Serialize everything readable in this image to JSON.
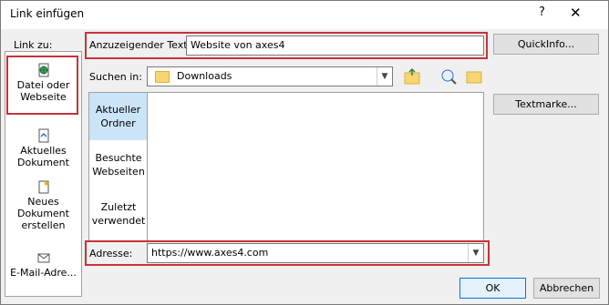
{
  "window": {
    "title": "Link einfügen",
    "help_label": "?",
    "close_label": "✕"
  },
  "link_to": {
    "label": "Link zu:",
    "items": [
      {
        "label": "Datei oder Webseite",
        "icon": "globe-file-icon",
        "selected": true
      },
      {
        "label": "Aktuelles Dokument",
        "icon": "document-arrow-icon",
        "selected": false
      },
      {
        "label": "Neues Dokument erstellen",
        "icon": "new-document-icon",
        "selected": false
      },
      {
        "label": "E-Mail-Adre...",
        "icon": "email-icon",
        "selected": false
      }
    ]
  },
  "display_text": {
    "label": "Anzuzeigender Text:",
    "value": "Website von axes4"
  },
  "quickinfo_button": "QuickInfo...",
  "search_in": {
    "label": "Suchen in:",
    "value": "Downloads"
  },
  "bookmark_button": "Textmarke...",
  "browse_tabs": [
    {
      "label": "Aktueller Ordner",
      "selected": true
    },
    {
      "label": "Besuchte Webseiten",
      "selected": false
    },
    {
      "label": "Zuletzt verwendet",
      "selected": false
    }
  ],
  "address": {
    "label": "Adresse:",
    "value": "https://www.axes4.com"
  },
  "ok_button": "OK",
  "cancel_button": "Abbrechen",
  "colors": {
    "highlight_box": "#c8323a",
    "selected_tab": "#cce4f7",
    "ok_border": "#0078d7"
  }
}
